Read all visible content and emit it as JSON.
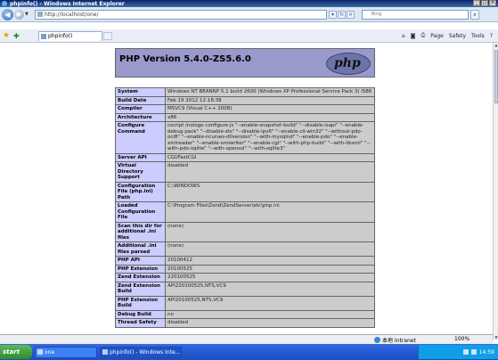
{
  "window": {
    "title": "phpinfo() - Windows Internet Explorer",
    "buttons": [
      "_",
      "□",
      "×"
    ]
  },
  "addressbar": {
    "url": "http://localhost/one/",
    "search_placeholder": "Bing"
  },
  "tabbar": {
    "tab_label": "phpinfo()",
    "tools": [
      "Page",
      "Safety",
      "Tools"
    ]
  },
  "page": {
    "php_version_title": "PHP Version 5.4.0-ZS5.6.0",
    "logo_text": "php",
    "rows": [
      {
        "key": "System",
        "value": "Windows NT BEANNP 5.1 build 2600 (Windows XP Professional Service Pack 3) i586"
      },
      {
        "key": "Build Date",
        "value": "Feb 19 2012 12:18:38"
      },
      {
        "key": "Compiler",
        "value": "MSVC9 (Visual C++ 2008)"
      },
      {
        "key": "Architecture",
        "value": "x86"
      },
      {
        "key": "Configure Command",
        "value": "cscript /nologo configure.js \"--enable-snapshot-build\" \"--disable-isapi\" \"--enable-debug-pack\" \"--disable-zts\" \"--disable-ipv6\" \"--enable-cli-win32\" \"--without-pdo-oci8\" \"--enable-ncurses-dllversion\" \"--with-mysqlnd\" \"--enable-pdo\" \"--enable-xmlreader\" \"--enable-xmlwriter\" \"--enable-cgi\" \"--with-php-build\" \"--with-libxml\" \"--with-pdo-sqlite\" \"--with-openssl\" \"--with-sqlite3\""
      },
      {
        "key": "Server API",
        "value": "CGI/FastCGI"
      },
      {
        "key": "Virtual Directory Support",
        "value": "disabled"
      },
      {
        "key": "Configuration File (php.ini) Path",
        "value": "C:\\WINDOWS"
      },
      {
        "key": "Loaded Configuration File",
        "value": "C:\\Program Files\\Zend\\ZendServer\\etc\\php.ini"
      },
      {
        "key": "Scan this dir for additional .ini files",
        "value": "(none)"
      },
      {
        "key": "Additional .ini files parsed",
        "value": "(none)"
      },
      {
        "key": "PHP API",
        "value": "20100412"
      },
      {
        "key": "PHP Extension",
        "value": "20100525"
      },
      {
        "key": "Zend Extension",
        "value": "220100525"
      },
      {
        "key": "Zend Extension Build",
        "value": "API220100525,NTS,VC9"
      },
      {
        "key": "PHP Extension Build",
        "value": "API20100525,NTS,VC9"
      },
      {
        "key": "Debug Build",
        "value": "no"
      },
      {
        "key": "Thread Safety",
        "value": "disabled"
      }
    ]
  },
  "statusbar": {
    "zone": "本地 Intranet",
    "zoom": "100%"
  },
  "taskbar": {
    "start": "start",
    "items": [
      "one",
      "phpinfo() - Windows Inte..."
    ],
    "clock": "14:59"
  }
}
